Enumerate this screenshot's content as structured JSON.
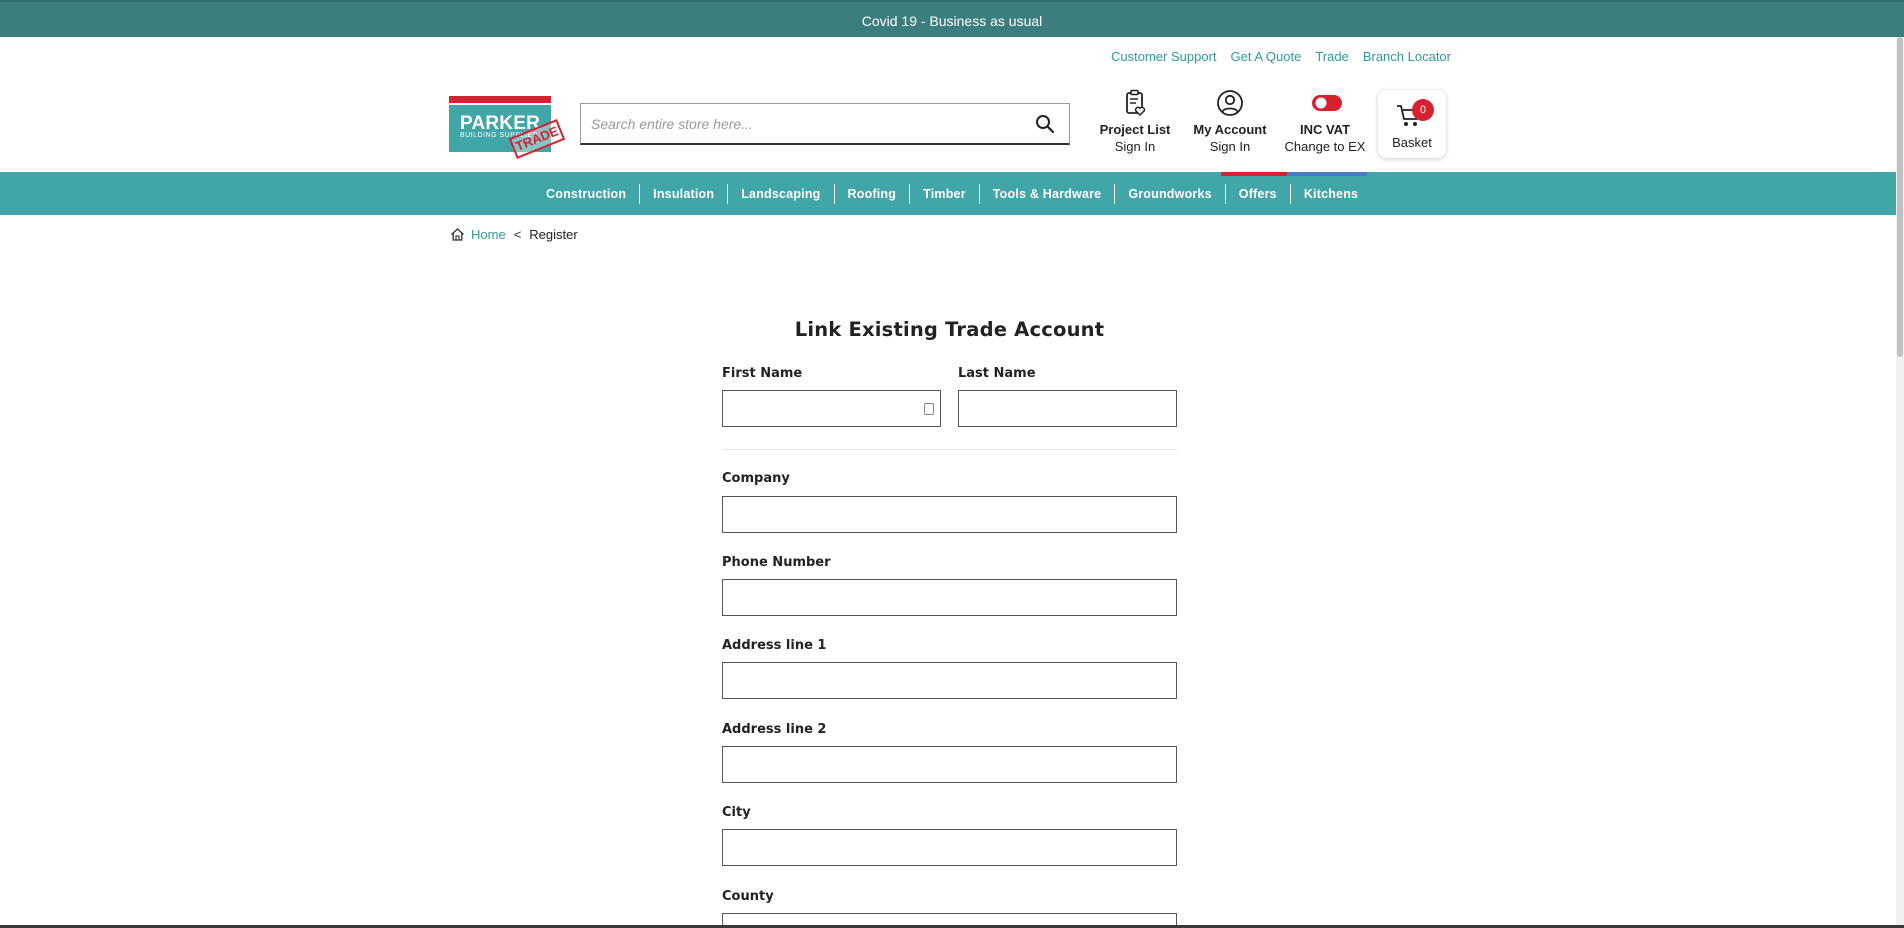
{
  "banner": {
    "text": "Covid 19 - Business as usual"
  },
  "toplinks": [
    "Customer Support",
    "Get A Quote",
    "Trade",
    "Branch Locator"
  ],
  "logo": {
    "brand": "PARKER",
    "sub": "BUILDING SUPPLIES",
    "stamp": "TRADE"
  },
  "search": {
    "placeholder": "Search entire store here..."
  },
  "header": {
    "project_list": {
      "title": "Project List",
      "sub": "Sign In"
    },
    "account": {
      "title": "My Account",
      "sub": "Sign In"
    },
    "vat": {
      "title": "INC VAT",
      "sub": "Change to EX"
    },
    "basket": {
      "label": "Basket",
      "count": "0"
    }
  },
  "nav": [
    "Construction",
    "Insulation",
    "Landscaping",
    "Roofing",
    "Timber",
    "Tools & Hardware",
    "Groundworks",
    "Offers",
    "Kitchens"
  ],
  "breadcrumb": {
    "home": "Home",
    "sep": "<",
    "current": "Register"
  },
  "form": {
    "title": "Link Existing Trade Account",
    "first_name": "First Name",
    "last_name": "Last Name",
    "company": "Company",
    "phone": "Phone Number",
    "address1": "Address line 1",
    "address2": "Address line 2",
    "city": "City",
    "county": "County"
  },
  "colors": {
    "teal": "#41a6a7",
    "dark_teal": "#3a7f7d",
    "red": "#d82130",
    "blue": "#4b79c5"
  }
}
